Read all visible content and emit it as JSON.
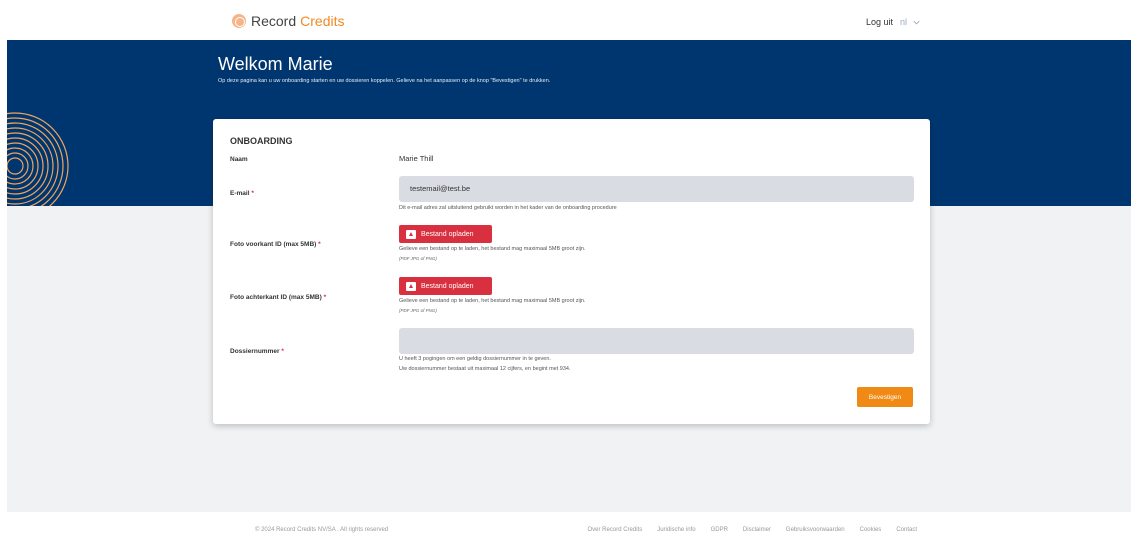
{
  "header": {
    "logo_part1": "Record",
    "logo_part2": "Credits",
    "logout_label": "Log uit",
    "language": "nl"
  },
  "hero": {
    "title": "Welkom Marie",
    "subtitle": "Op deze pagina kan u uw onboarding starten en uw dossieren koppelen. Gelieve na het aanpassen op de knop \"Bevestigen\" te drukken."
  },
  "card": {
    "title": "ONBOARDING",
    "name_label": "Naam",
    "name_value": "Marie Thill",
    "email_label": "E-mail",
    "email_value": "testemail@test.be",
    "email_help": "Dit e-mail adres zal uitsluitend gebruikt worden in het kader van de onboarding procedure",
    "front_id_label": "Foto voorkant ID (max 5MB)",
    "back_id_label": "Foto achterkant ID (max 5MB)",
    "upload_button_label": "Bestand opladen",
    "upload_help": "Gelieve een bestand op te laden, het bestand mag maximaal 5MB groot zijn.",
    "upload_formats": "(PDF JPG of PNG)",
    "dossier_label": "Dossiernummer",
    "dossier_value": "",
    "dossier_help_1": "U heeft 3 pogingen om een geldig dossiernummer in te geven.",
    "dossier_help_2": "Uw dossiernummer bestaat uit maximaal 12 cijfers, en begint met 934.",
    "required_marker": "*",
    "confirm_label": "Bevestigen"
  },
  "footer": {
    "copyright": "© 2024 Record Credits NV/SA . All rights reserved",
    "links": [
      "Over Record Credits",
      "Juridische info",
      "GDPR",
      "Disclaimer",
      "Gebruiksvoorwaarden",
      "Cookies",
      "Contact"
    ]
  },
  "colors": {
    "hero_bg": "#003670",
    "brand_orange": "#f08a24",
    "upload_red": "#d8303f",
    "confirm_orange": "#f08a14",
    "input_bg": "#d9dde3"
  },
  "icons": {
    "logo": "logo-mark-icon",
    "language_dropdown": "chevron-down-icon",
    "upload": "upload-icon",
    "decoration": "fingerprint-icon"
  }
}
